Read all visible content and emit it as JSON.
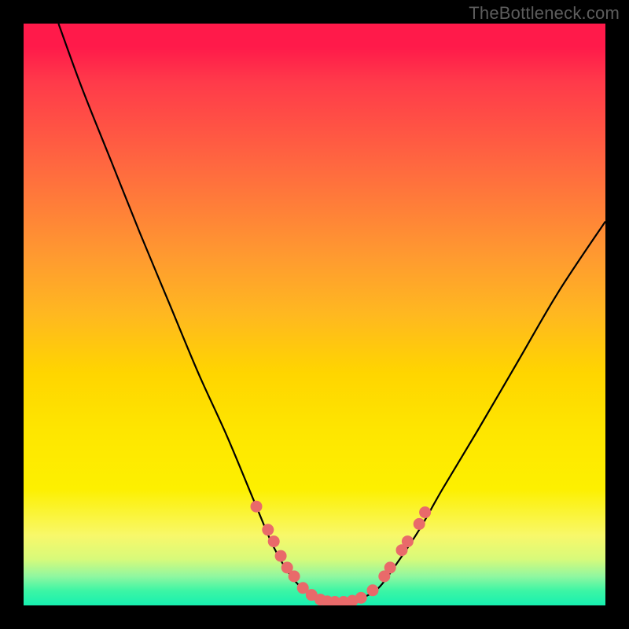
{
  "watermark": "TheBottleneck.com",
  "colors": {
    "background": "#000000",
    "curve": "#000000",
    "bead": "#e96a6a",
    "gradient_top": "#ff1a4a",
    "gradient_mid": "#ffd500",
    "gradient_bottom": "#17f0b0"
  },
  "chart_data": {
    "type": "line",
    "title": "",
    "xlabel": "",
    "ylabel": "",
    "xlim": [
      0,
      100
    ],
    "ylim": [
      0,
      100
    ],
    "note": "Values estimated from pixel positions; y=0 is bottom, y=100 is top. The plot is a bottleneck-style V curve with minimum near x≈53.",
    "series": [
      {
        "name": "left-branch",
        "x": [
          6,
          10,
          15,
          20,
          25,
          30,
          35,
          40,
          43,
          46,
          49,
          52,
          54
        ],
        "y": [
          100,
          89,
          76.5,
          64,
          52,
          40,
          29,
          17,
          10,
          5,
          2,
          0.7,
          0.5
        ]
      },
      {
        "name": "right-branch",
        "x": [
          54,
          56,
          58,
          61,
          64,
          68,
          72,
          78,
          85,
          92,
          100
        ],
        "y": [
          0.5,
          0.7,
          1.2,
          3,
          7,
          13,
          20,
          30,
          42,
          54,
          66
        ]
      }
    ],
    "beads": {
      "name": "highlighted-points",
      "note": "Salmon circular markers clustered near the trough of the curve.",
      "points": [
        {
          "x": 40.0,
          "y": 17.0
        },
        {
          "x": 42.0,
          "y": 13.0
        },
        {
          "x": 43.0,
          "y": 11.0
        },
        {
          "x": 44.2,
          "y": 8.5
        },
        {
          "x": 45.3,
          "y": 6.5
        },
        {
          "x": 46.5,
          "y": 5.0
        },
        {
          "x": 48.0,
          "y": 3.0
        },
        {
          "x": 49.5,
          "y": 1.8
        },
        {
          "x": 51.0,
          "y": 1.0
        },
        {
          "x": 52.2,
          "y": 0.7
        },
        {
          "x": 53.5,
          "y": 0.6
        },
        {
          "x": 55.0,
          "y": 0.6
        },
        {
          "x": 56.5,
          "y": 0.8
        },
        {
          "x": 58.0,
          "y": 1.3
        },
        {
          "x": 60.0,
          "y": 2.6
        },
        {
          "x": 62.0,
          "y": 5.0
        },
        {
          "x": 63.0,
          "y": 6.5
        },
        {
          "x": 65.0,
          "y": 9.5
        },
        {
          "x": 66.0,
          "y": 11.0
        },
        {
          "x": 68.0,
          "y": 14.0
        },
        {
          "x": 69.0,
          "y": 16.0
        }
      ]
    }
  }
}
